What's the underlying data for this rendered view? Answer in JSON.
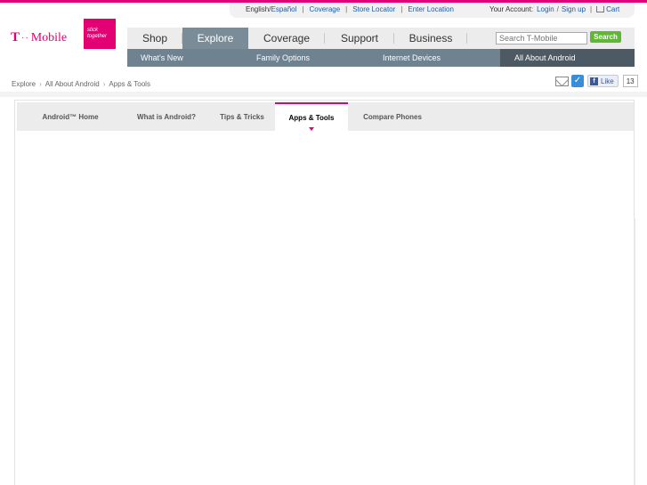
{
  "utility": {
    "lang_english": "English",
    "lang_spanish": "Español",
    "coverage": "Coverage",
    "store_locator": "Store Locator",
    "enter_location": "Enter Location",
    "account_label": "Your Account:",
    "login": "Login",
    "signup": "Sign up",
    "cart": "Cart"
  },
  "logo": {
    "brand": "Mobile",
    "badge_line1": "stick",
    "badge_line2": "together"
  },
  "main_nav": {
    "items": [
      {
        "label": "Shop"
      },
      {
        "label": "Explore"
      },
      {
        "label": "Coverage"
      },
      {
        "label": "Support"
      },
      {
        "label": "Business"
      }
    ],
    "active_index": 1,
    "search_placeholder": "Search T-Mobile",
    "search_button": "Search"
  },
  "sub_nav": {
    "items": [
      {
        "label": "What's New"
      },
      {
        "label": "Family Options"
      },
      {
        "label": "Internet Devices"
      },
      {
        "label": "All About Android"
      }
    ],
    "active_index": 3
  },
  "breadcrumb": {
    "items": [
      "Explore",
      "All About Android",
      "Apps & Tools"
    ]
  },
  "social": {
    "like_label": "Like",
    "like_count": "13"
  },
  "tabs": {
    "items": [
      {
        "label": "Android™ Home"
      },
      {
        "label": "What is Android?"
      },
      {
        "label": "Tips & Tricks"
      },
      {
        "label": "Apps & Tools"
      },
      {
        "label": "Compare Phones"
      }
    ],
    "active_index": 3
  },
  "colors": {
    "brand_magenta": "#e20074",
    "nav_active": "#7a8c98",
    "subnav_bg": "#6f8290",
    "subnav_active": "#4d5a63",
    "search_green": "#5fb833"
  }
}
